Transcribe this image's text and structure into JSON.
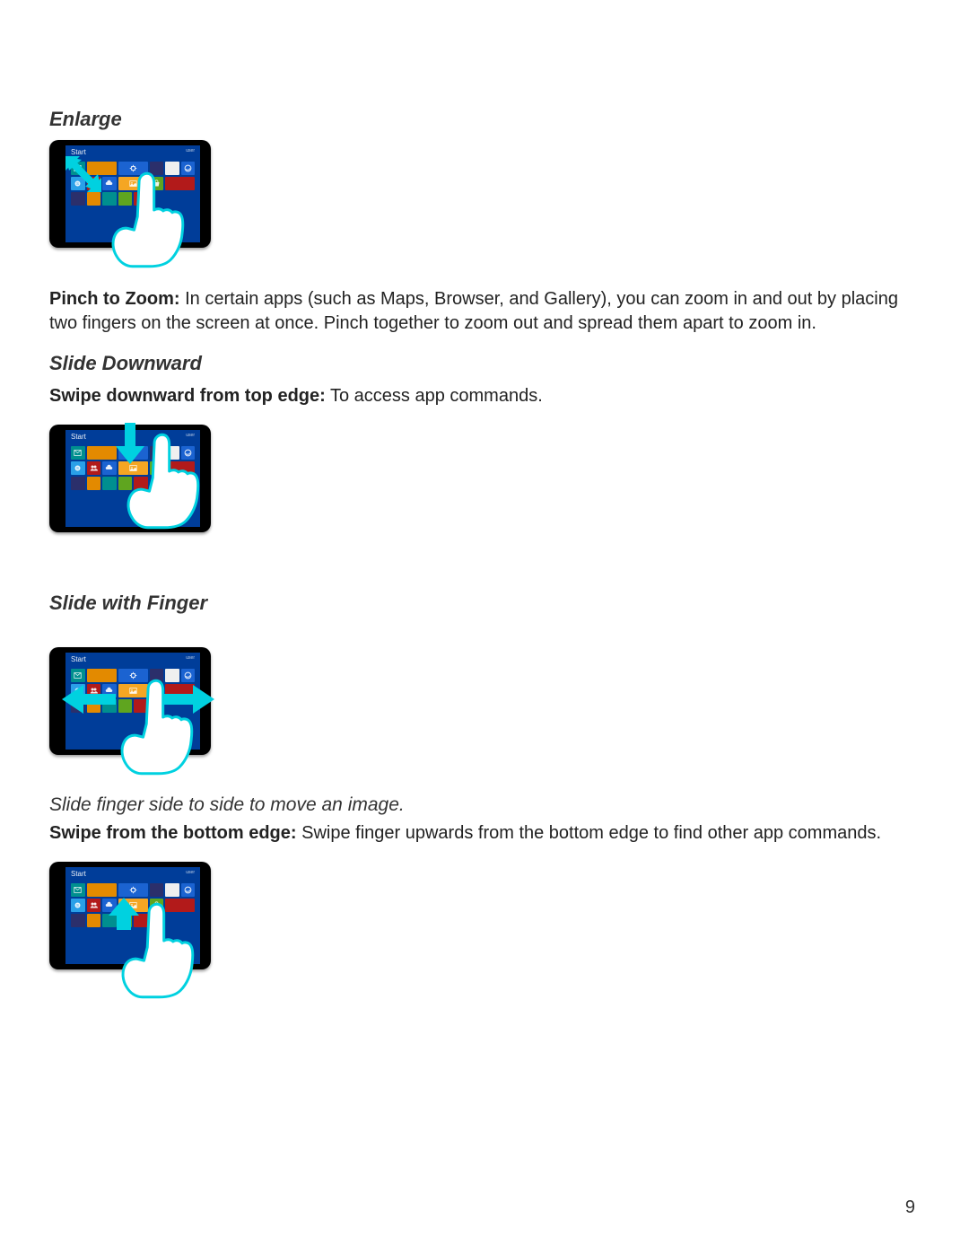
{
  "page_number": "9",
  "sections": {
    "enlarge": {
      "heading": "Enlarge",
      "para_bold": "Pinch to Zoom:",
      "para_rest": " In certain apps (such as Maps, Browser, and Gallery), you can zoom in and out by placing two fingers on the screen at once. Pinch together to zoom out and spread them apart to zoom in."
    },
    "slide_down": {
      "heading": "Slide Downward",
      "para_bold": "Swipe downward from top edge:",
      "para_rest": " To access app commands."
    },
    "slide_side": {
      "heading": "Slide with Finger",
      "subline": "Slide finger side to side to move an image.",
      "para_bold": "Swipe from the bottom edge:",
      "para_rest": " Swipe finger upwards from the bottom edge to find other app commands."
    }
  },
  "tablet_ui": {
    "start_label": "Start",
    "user_label": "user"
  }
}
